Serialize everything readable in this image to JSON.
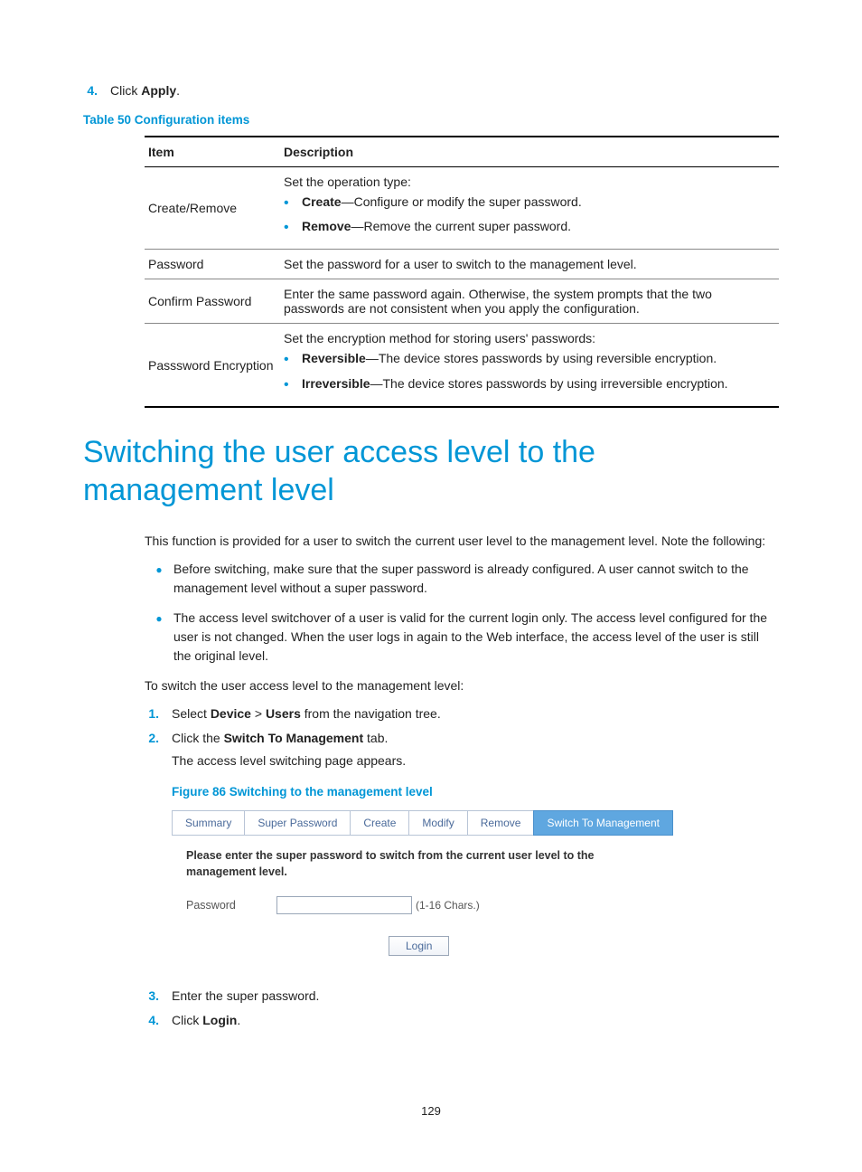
{
  "step4": {
    "num": "4.",
    "prefix": "Click ",
    "bold": "Apply",
    "suffix": "."
  },
  "table_caption": "Table 50 Configuration items",
  "table_headers": {
    "item": "Item",
    "desc": "Description"
  },
  "row1": {
    "item": "Create/Remove",
    "lead": "Set the operation type:",
    "b1_bold": "Create",
    "b1_rest": "—Configure or modify the super password.",
    "b2_bold": "Remove",
    "b2_rest": "—Remove the current super password."
  },
  "row2": {
    "item": "Password",
    "desc": "Set the password for a user to switch to the management level."
  },
  "row3": {
    "item": "Confirm Password",
    "desc": "Enter the same password again. Otherwise, the system prompts that the two passwords are not consistent when you apply the configuration."
  },
  "row4": {
    "item": "Passsword Encryption",
    "lead": "Set the encryption method for storing users' passwords:",
    "b1_bold": "Reversible",
    "b1_rest": "—The device stores passwords by using reversible encryption.",
    "b2_bold": "Irreversible",
    "b2_rest": "—The device stores passwords by using irreversible encryption."
  },
  "heading": "Switching the user access level to the management level",
  "intro": "This function is provided for a user to switch the current user level to the management level. Note the following:",
  "notes": [
    "Before switching, make sure that the super password is already configured. A user cannot switch to the management level without a super password.",
    "The access level switchover of a user is valid for the current login only. The access level configured for the user is not changed. When the user logs in again to the Web interface, the access level of the user is still the original level."
  ],
  "to_switch": "To switch the user access level to the management level:",
  "ol1": {
    "num": "1.",
    "p1": "Select ",
    "b1": "Device",
    "p2": " > ",
    "b2": "Users",
    "p3": " from the navigation tree."
  },
  "ol2": {
    "num": "2.",
    "p1": "Click the ",
    "b1": "Switch To Management",
    "p2": " tab.",
    "sub": "The access level switching page appears."
  },
  "fig_caption": "Figure 86 Switching to the management level",
  "ui": {
    "tabs": [
      "Summary",
      "Super Password",
      "Create",
      "Modify",
      "Remove",
      "Switch To Management"
    ],
    "active_tab_index": 5,
    "instruction": "Please enter the super password to switch from the current user level to the management level.",
    "pw_label": "Password",
    "pw_hint": "(1-16 Chars.)",
    "login_btn": "Login"
  },
  "ol3": {
    "num": "3.",
    "text": "Enter the super password."
  },
  "ol4": {
    "num": "4.",
    "p1": "Click ",
    "b1": "Login",
    "p2": "."
  },
  "page_number": "129"
}
